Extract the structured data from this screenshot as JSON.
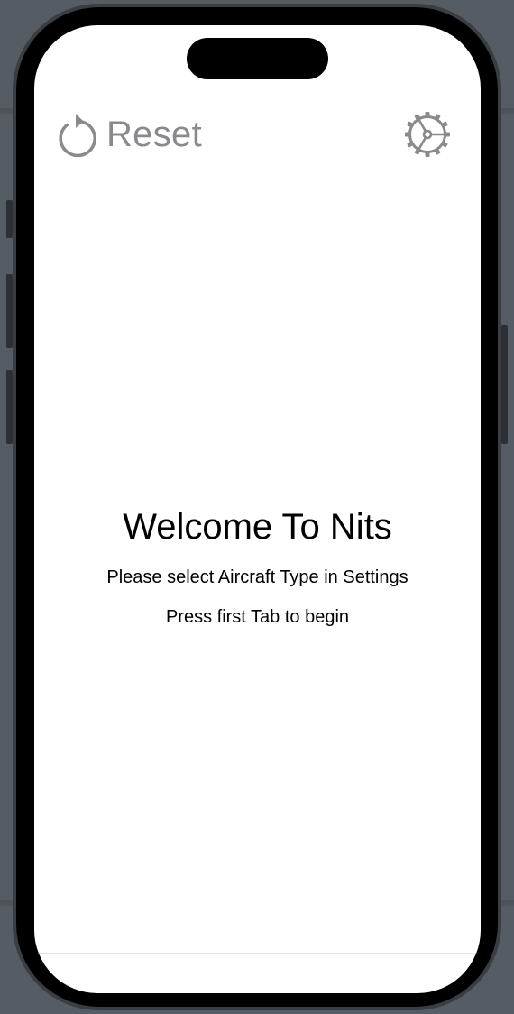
{
  "toolbar": {
    "reset_label": "Reset",
    "reset_icon": "reset-arrow-icon",
    "settings_icon": "gear-icon",
    "icon_color": "#8a8a8e"
  },
  "welcome": {
    "title": "Welcome To Nits",
    "line1": "Please select Aircraft Type in Settings",
    "line2": "Press first Tab to begin"
  }
}
